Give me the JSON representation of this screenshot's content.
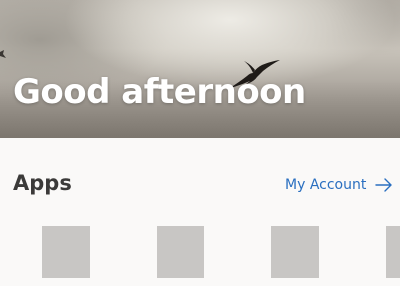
{
  "hero": {
    "greeting": "Good afternoon",
    "background_description": "cloudy-sky-with-bird",
    "bird_icon": "bird-silhouette-icon"
  },
  "apps_section": {
    "title": "Apps",
    "account_link": {
      "label": "My Account",
      "icon": "arrow-right-icon"
    },
    "tiles_count_visible": 4
  },
  "colors": {
    "page_background": "#faf9f8",
    "link": "#2a6fc0",
    "heading_text": "#3b3a39",
    "tile_placeholder": "#c8c6c4",
    "hero_text": "#ffffff"
  }
}
